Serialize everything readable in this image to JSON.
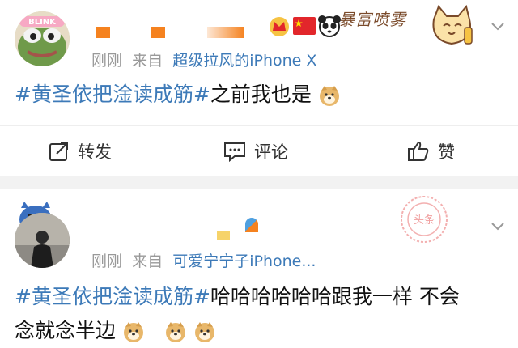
{
  "post1": {
    "avatar_badge": "BLINK",
    "time": "刚刚",
    "from_label": "来自",
    "source": "超级拉风的iPhone X",
    "topic": "#黄圣依把淦读成筋#",
    "text": "之前我也是",
    "vip_badge_text": "暴富喷雾"
  },
  "actions": {
    "repost": "转发",
    "comment": "评论",
    "like": "赞"
  },
  "post2": {
    "time": "刚刚",
    "from_label": "来自",
    "source": "可爱宁宁子iPhone...",
    "topic": "#黄圣依把淦读成筋#",
    "text_line1": "哈哈哈哈哈哈跟我一样 不会",
    "text_line2": "念就念半边",
    "stamp_text": "头条"
  },
  "colors": {
    "link_blue": "#3d7ab8",
    "gray_text": "#999999",
    "divider": "#f2f2f2",
    "orange_mask": "#f5821f"
  },
  "icons": [
    "chevron-down-icon",
    "repost-icon",
    "comment-icon",
    "like-icon",
    "doge-emoji",
    "crown-badge-icon",
    "china-flag-icon",
    "panda-icon",
    "cat-badge-icon"
  ]
}
